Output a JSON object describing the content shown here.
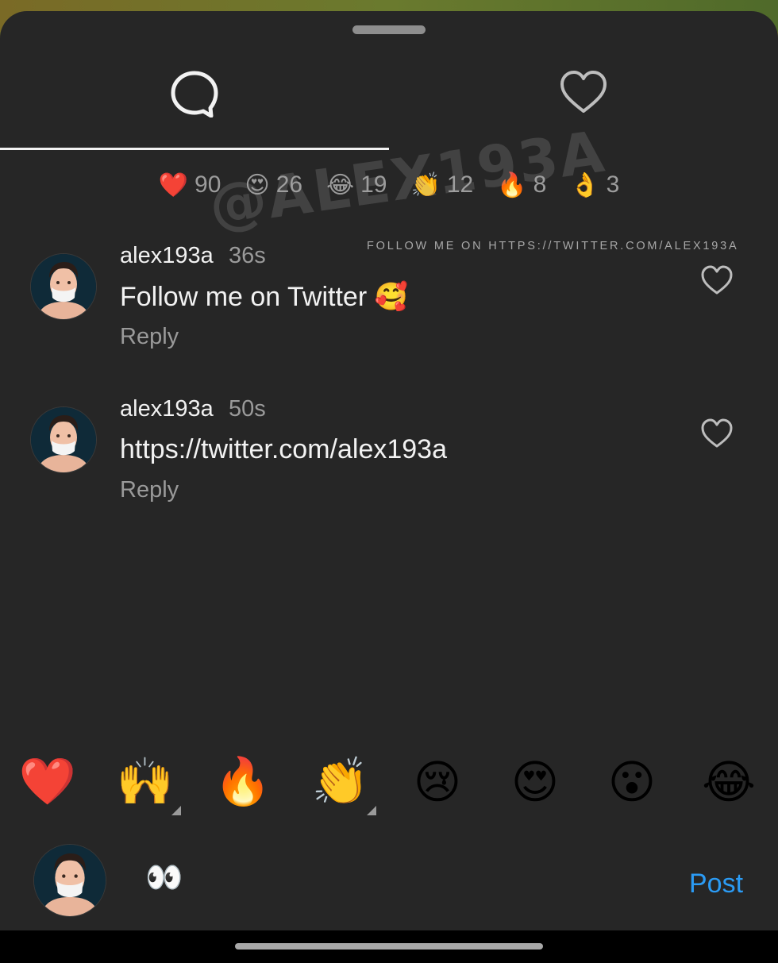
{
  "tabs": [
    {
      "name": "comments",
      "icon": "comment-bubble-icon",
      "active": true
    },
    {
      "name": "likes",
      "icon": "heart-outline-icon",
      "active": false
    }
  ],
  "reactions": [
    {
      "emoji": "❤️",
      "count": "90"
    },
    {
      "emoji": "😍",
      "count": "26"
    },
    {
      "emoji": "😂",
      "count": "19"
    },
    {
      "emoji": "👏",
      "count": "12"
    },
    {
      "emoji": "🔥",
      "count": "8"
    },
    {
      "emoji": "👌",
      "count": "3"
    }
  ],
  "watermark": {
    "handle": "@ALEX193A",
    "note": "FOLLOW ME ON HTTPS://TWITTER.COM/ALEX193A"
  },
  "comments": [
    {
      "user": "alex193a",
      "time": "36s",
      "text": "Follow me on Twitter 🥰",
      "reply": "Reply"
    },
    {
      "user": "alex193a",
      "time": "50s",
      "text": "https://twitter.com/alex193a",
      "reply": "Reply"
    }
  ],
  "quick_emojis": [
    "❤️",
    "🙌",
    "🔥",
    "👏",
    "😢",
    "😍",
    "😮",
    "😂"
  ],
  "composer": {
    "input_value": "👀",
    "post_label": "Post"
  },
  "colors": {
    "background": "#262626",
    "text": "#f2f2f2",
    "muted": "#9a9a9a",
    "accent": "#2b9bf4"
  }
}
